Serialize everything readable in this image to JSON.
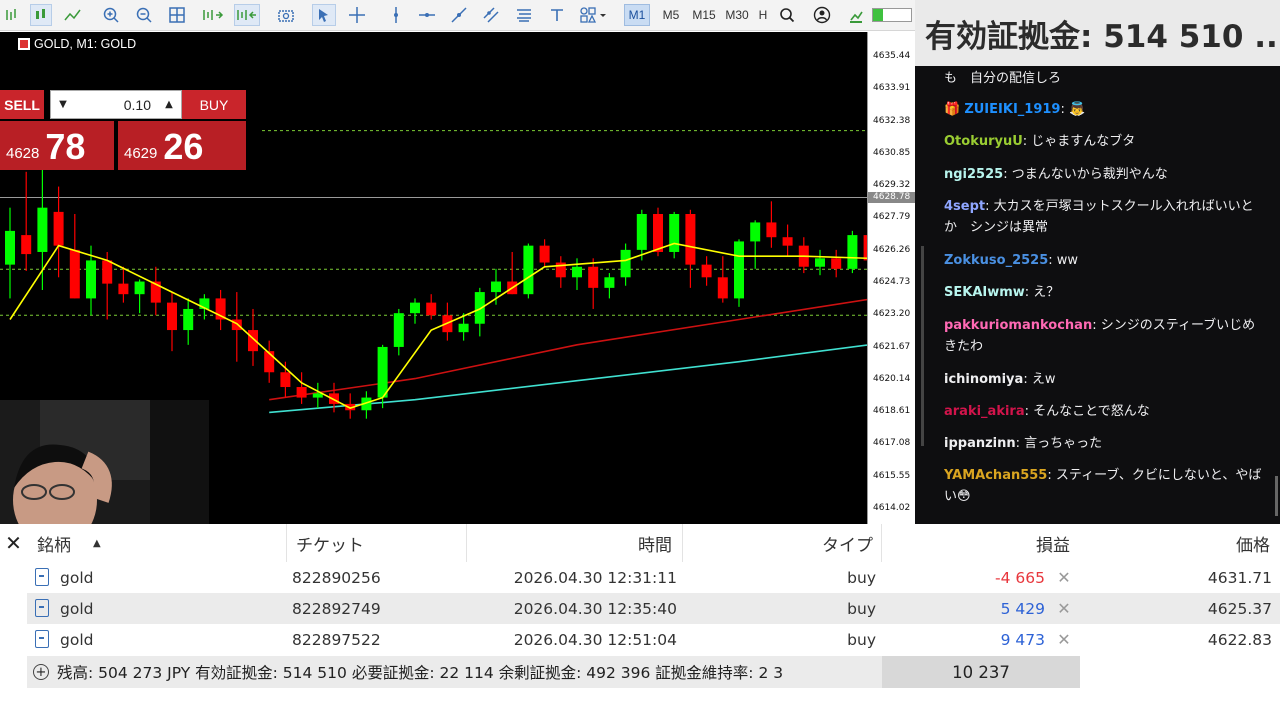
{
  "toolbar": {
    "timeframes": [
      "M1",
      "M5",
      "M15",
      "M30",
      "H"
    ],
    "active_timeframe": "M1"
  },
  "margin_overlay": {
    "text": "有効証拠金: 514 510 ..."
  },
  "chart": {
    "title": "GOLD, M1:  GOLD",
    "symbol": "GOLD",
    "axis_labels": [
      "4635.44",
      "4633.91",
      "4632.38",
      "4630.85",
      "4629.32",
      "4627.79",
      "4626.26",
      "4624.73",
      "4623.20",
      "4621.67",
      "4620.14",
      "4618.61",
      "4617.08",
      "4615.55",
      "4614.02"
    ],
    "current_price_label": "4628.78",
    "colors": {
      "bull": "#00ff00",
      "bear": "#ff0000",
      "ma_fast": "#ffff00",
      "ma_mid": "#cc1111",
      "ma_slow": "#40e0d0",
      "level": "#7ccc35"
    }
  },
  "chart_data": {
    "type": "candlestick",
    "symbol": "GOLD",
    "timeframe": "M1",
    "ylim": [
      4614.02,
      4635.44
    ],
    "horizontal_levels": [
      4631.95,
      4625.38,
      4623.2
    ],
    "candles": [
      {
        "o": 4625.6,
        "h": 4628.3,
        "l": 4624.0,
        "c": 4627.2
      },
      {
        "o": 4627.0,
        "h": 4630.0,
        "l": 4625.3,
        "c": 4626.1
      },
      {
        "o": 4626.2,
        "h": 4631.0,
        "l": 4624.4,
        "c": 4628.3
      },
      {
        "o": 4628.1,
        "h": 4629.3,
        "l": 4625.0,
        "c": 4626.5
      },
      {
        "o": 4626.3,
        "h": 4628.0,
        "l": 4624.0,
        "c": 4624.0
      },
      {
        "o": 4624.0,
        "h": 4626.5,
        "l": 4623.2,
        "c": 4625.8
      },
      {
        "o": 4625.8,
        "h": 4626.2,
        "l": 4623.0,
        "c": 4624.7
      },
      {
        "o": 4624.7,
        "h": 4625.5,
        "l": 4623.8,
        "c": 4624.2
      },
      {
        "o": 4624.2,
        "h": 4624.9,
        "l": 4623.3,
        "c": 4624.8
      },
      {
        "o": 4624.8,
        "h": 4625.5,
        "l": 4623.2,
        "c": 4623.8
      },
      {
        "o": 4623.8,
        "h": 4624.3,
        "l": 4621.5,
        "c": 4622.5
      },
      {
        "o": 4622.5,
        "h": 4624.0,
        "l": 4621.8,
        "c": 4623.5
      },
      {
        "o": 4623.5,
        "h": 4624.2,
        "l": 4623.0,
        "c": 4624.0
      },
      {
        "o": 4624.0,
        "h": 4624.4,
        "l": 4622.5,
        "c": 4623.0
      },
      {
        "o": 4623.0,
        "h": 4624.3,
        "l": 4621.0,
        "c": 4622.5
      },
      {
        "o": 4622.5,
        "h": 4623.5,
        "l": 4620.8,
        "c": 4621.5
      },
      {
        "o": 4621.5,
        "h": 4622.0,
        "l": 4620.0,
        "c": 4620.5
      },
      {
        "o": 4620.5,
        "h": 4621.0,
        "l": 4619.3,
        "c": 4619.8
      },
      {
        "o": 4619.8,
        "h": 4620.5,
        "l": 4619.0,
        "c": 4619.3
      },
      {
        "o": 4619.3,
        "h": 4620.0,
        "l": 4618.8,
        "c": 4619.5
      },
      {
        "o": 4619.5,
        "h": 4620.0,
        "l": 4618.6,
        "c": 4619.0
      },
      {
        "o": 4619.0,
        "h": 4619.5,
        "l": 4618.3,
        "c": 4618.7
      },
      {
        "o": 4618.7,
        "h": 4619.6,
        "l": 4618.3,
        "c": 4619.3
      },
      {
        "o": 4619.3,
        "h": 4621.8,
        "l": 4618.8,
        "c": 4621.7
      },
      {
        "o": 4621.7,
        "h": 4623.5,
        "l": 4621.3,
        "c": 4623.3
      },
      {
        "o": 4623.3,
        "h": 4624.0,
        "l": 4622.8,
        "c": 4623.8
      },
      {
        "o": 4623.8,
        "h": 4624.2,
        "l": 4623.0,
        "c": 4623.2
      },
      {
        "o": 4623.2,
        "h": 4623.8,
        "l": 4622.0,
        "c": 4622.4
      },
      {
        "o": 4622.4,
        "h": 4623.3,
        "l": 4622.0,
        "c": 4622.8
      },
      {
        "o": 4622.8,
        "h": 4624.5,
        "l": 4622.2,
        "c": 4624.3
      },
      {
        "o": 4624.3,
        "h": 4625.4,
        "l": 4623.7,
        "c": 4624.8
      },
      {
        "o": 4624.8,
        "h": 4626.2,
        "l": 4624.2,
        "c": 4624.2
      },
      {
        "o": 4624.2,
        "h": 4626.6,
        "l": 4624.0,
        "c": 4626.5
      },
      {
        "o": 4626.5,
        "h": 4626.8,
        "l": 4625.5,
        "c": 4625.7
      },
      {
        "o": 4625.7,
        "h": 4626.0,
        "l": 4624.5,
        "c": 4625.0
      },
      {
        "o": 4625.0,
        "h": 4625.9,
        "l": 4624.4,
        "c": 4625.5
      },
      {
        "o": 4625.5,
        "h": 4625.9,
        "l": 4623.5,
        "c": 4624.5
      },
      {
        "o": 4624.5,
        "h": 4625.2,
        "l": 4624.0,
        "c": 4625.0
      },
      {
        "o": 4625.0,
        "h": 4626.6,
        "l": 4624.6,
        "c": 4626.3
      },
      {
        "o": 4626.3,
        "h": 4628.2,
        "l": 4625.8,
        "c": 4628.0
      },
      {
        "o": 4628.0,
        "h": 4628.3,
        "l": 4626.0,
        "c": 4626.2
      },
      {
        "o": 4626.2,
        "h": 4628.1,
        "l": 4625.9,
        "c": 4628.0
      },
      {
        "o": 4628.0,
        "h": 4628.2,
        "l": 4624.5,
        "c": 4625.6
      },
      {
        "o": 4625.6,
        "h": 4626.0,
        "l": 4624.6,
        "c": 4625.0
      },
      {
        "o": 4625.0,
        "h": 4626.0,
        "l": 4623.8,
        "c": 4624.0
      },
      {
        "o": 4624.0,
        "h": 4626.8,
        "l": 4623.6,
        "c": 4626.7
      },
      {
        "o": 4626.7,
        "h": 4627.7,
        "l": 4625.4,
        "c": 4627.6
      },
      {
        "o": 4627.6,
        "h": 4628.6,
        "l": 4626.4,
        "c": 4626.9
      },
      {
        "o": 4626.9,
        "h": 4627.5,
        "l": 4626.0,
        "c": 4626.5
      },
      {
        "o": 4626.5,
        "h": 4626.9,
        "l": 4625.2,
        "c": 4625.5
      },
      {
        "o": 4625.5,
        "h": 4626.3,
        "l": 4625.1,
        "c": 4625.9
      },
      {
        "o": 4625.9,
        "h": 4626.3,
        "l": 4625.0,
        "c": 4625.4
      },
      {
        "o": 4625.4,
        "h": 4627.2,
        "l": 4625.2,
        "c": 4627.0
      },
      {
        "o": 4627.0,
        "h": 4627.2,
        "l": 4625.5,
        "c": 4625.8
      },
      {
        "o": 4625.8,
        "h": 4627.3,
        "l": 4625.4,
        "c": 4626.9
      },
      {
        "o": 4626.9,
        "h": 4627.8,
        "l": 4625.0,
        "c": 4625.2
      },
      {
        "o": 4625.2,
        "h": 4626.3,
        "l": 4624.9,
        "c": 4626.2
      },
      {
        "o": 4626.2,
        "h": 4628.1,
        "l": 4626.0,
        "c": 4628.0
      },
      {
        "o": 4628.0,
        "h": 4631.6,
        "l": 4627.6,
        "c": 4631.4
      },
      {
        "o": 4631.4,
        "h": 4632.0,
        "l": 4629.0,
        "c": 4629.2
      },
      {
        "o": 4629.2,
        "h": 4631.7,
        "l": 4628.7,
        "c": 4631.5
      },
      {
        "o": 4631.5,
        "h": 4631.6,
        "l": 4628.8,
        "c": 4629.2
      },
      {
        "o": 4629.2,
        "h": 4630.4,
        "l": 4628.9,
        "c": 4630.0
      },
      {
        "o": 4630.0,
        "h": 4630.1,
        "l": 4628.5,
        "c": 4628.6
      }
    ],
    "ma_fast": [
      [
        0,
        4623.0
      ],
      [
        3,
        4626.5
      ],
      [
        6,
        4625.8
      ],
      [
        10,
        4624.3
      ],
      [
        14,
        4622.8
      ],
      [
        18,
        4620.0
      ],
      [
        21,
        4618.8
      ],
      [
        23,
        4619.3
      ],
      [
        26,
        4622.5
      ],
      [
        29,
        4623.5
      ],
      [
        33,
        4625.5
      ],
      [
        38,
        4625.8
      ],
      [
        41,
        4626.6
      ],
      [
        45,
        4626.0
      ],
      [
        49,
        4626.0
      ],
      [
        53,
        4625.9
      ],
      [
        56,
        4626.8
      ],
      [
        59,
        4628.5
      ],
      [
        63,
        4629.6
      ]
    ],
    "ma_mid": [
      [
        16,
        4619.2
      ],
      [
        25,
        4620.2
      ],
      [
        35,
        4621.8
      ],
      [
        45,
        4623.0
      ],
      [
        55,
        4624.2
      ],
      [
        63,
        4624.9
      ]
    ],
    "ma_slow": [
      [
        16,
        4618.6
      ],
      [
        25,
        4619.2
      ],
      [
        35,
        4620.1
      ],
      [
        45,
        4621.0
      ],
      [
        55,
        4622.0
      ],
      [
        63,
        4622.9
      ]
    ]
  },
  "trade_panel": {
    "sell_label": "SELL",
    "buy_label": "BUY",
    "lot": "0.10",
    "sell_price_small": "4628",
    "sell_price_big": "78",
    "buy_price_small": "4629",
    "buy_price_big": "26"
  },
  "chat": {
    "messages": [
      {
        "user": "",
        "text": "も　自分の配信しろ",
        "color": "#efeff1"
      },
      {
        "user": "ZUIEIKI_1919",
        "text": ": 👼",
        "color": "#1e90ff",
        "badge": true
      },
      {
        "user": "OtokuryuU",
        "text": ": じゃますんなブタ",
        "color": "#9acd32"
      },
      {
        "user": "ngi2525",
        "text": ": つまんないから裁判やんな",
        "color": "#b8f5ee"
      },
      {
        "user": "4sept",
        "text": ": 大カスを戸塚ヨットスクール入れればいいとか　シンジは異常",
        "color": "#8fa6ff"
      },
      {
        "user": "Zokkuso_2525",
        "text": ": ww",
        "color": "#4a90e2"
      },
      {
        "user": "SEKAIwmw",
        "text": ": え？",
        "color": "#b8f5ee"
      },
      {
        "user": "pakkuriomankochan",
        "text": ": シンジのスティーブいじめきたわ",
        "color": "#ff69b4"
      },
      {
        "user": "ichinomiya",
        "text": ": えw",
        "color": "#efeff1"
      },
      {
        "user": "araki_akira",
        "text": ": そんなことで怒んな",
        "color": "#d2144b"
      },
      {
        "user": "ippanzinn",
        "text": ": 言っちゃった",
        "color": "#efeff1"
      },
      {
        "user": "YAMAchan555",
        "text": ": スティーブ、クビにしないと、やばい😳",
        "color": "#daa520"
      }
    ]
  },
  "positions": {
    "headers": {
      "symbol": "銘柄",
      "ticket": "チケット",
      "time": "時間",
      "type": "タイプ",
      "profit": "損益",
      "price": "価格"
    },
    "rows": [
      {
        "symbol": "gold",
        "ticket": "822890256",
        "time": "2026.04.30 12:31:11",
        "type": "buy",
        "profit": "-4 665",
        "price": "4631.71",
        "profit_color": "#e8363c"
      },
      {
        "symbol": "gold",
        "ticket": "822892749",
        "time": "2026.04.30 12:35:40",
        "type": "buy",
        "profit": "5 429",
        "price": "4625.37",
        "profit_color": "#2d62d6"
      },
      {
        "symbol": "gold",
        "ticket": "822897522",
        "time": "2026.04.30 12:51:04",
        "type": "buy",
        "profit": "9 473",
        "price": "4622.83",
        "profit_color": "#2d62d6"
      }
    ],
    "summary": "残高: 504 273 JPY  有効証拠金: 514 510  必要証拠金: 22 114  余剰証拠金: 492 396  証拠金維持率: 2 3",
    "total_profit": "10 237"
  }
}
